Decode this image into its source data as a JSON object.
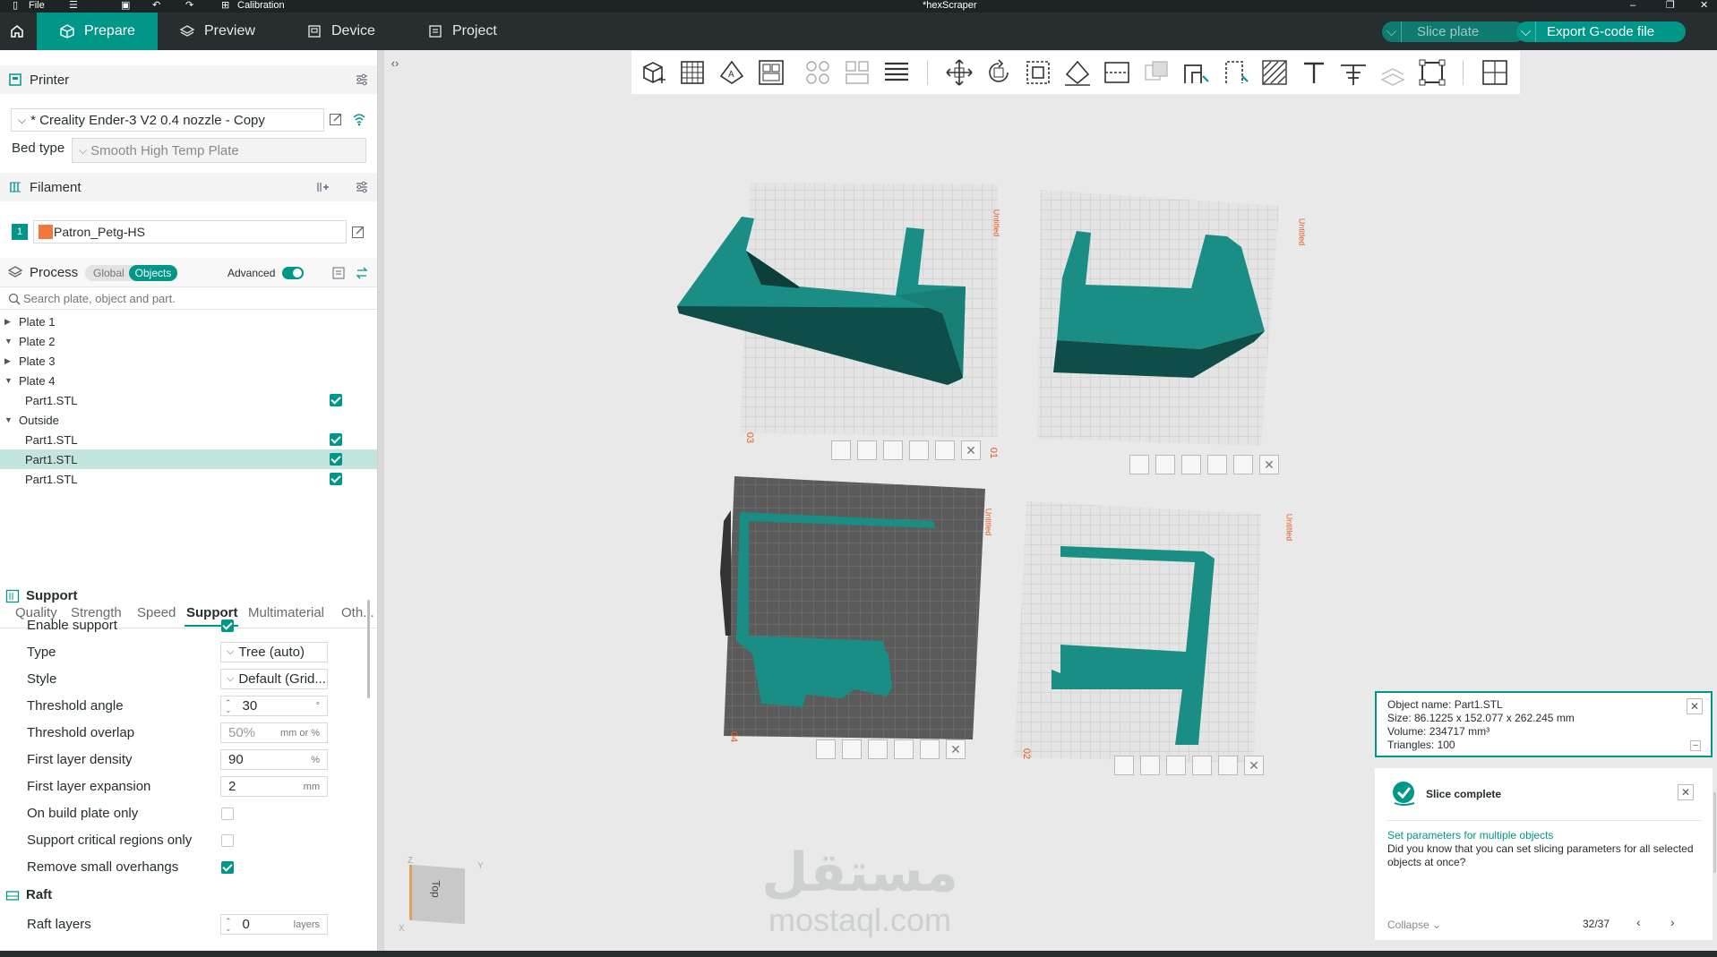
{
  "titlebar": {
    "file_label": "File",
    "calibration_label": "Calibration",
    "doc_title": "*hexScraper"
  },
  "nav": {
    "tabs": [
      {
        "label": "Prepare",
        "icon": "cube-icon"
      },
      {
        "label": "Preview",
        "icon": "layers-icon"
      },
      {
        "label": "Device",
        "icon": "device-icon"
      },
      {
        "label": "Project",
        "icon": "project-icon"
      }
    ],
    "slice_label": "Slice plate",
    "export_label": "Export G-code file"
  },
  "printer": {
    "section_label": "Printer",
    "name": "* Creality Ender-3 V2 0.4 nozzle - Copy",
    "bed_type_label": "Bed type",
    "bed_type_value": "Smooth High Temp Plate"
  },
  "filament": {
    "section_label": "Filament",
    "slot": "1",
    "name": "Patron_Petg-HS",
    "color": "#f07838"
  },
  "process": {
    "section_label": "Process",
    "global_label": "Global",
    "objects_label": "Objects",
    "advanced_label": "Advanced",
    "search_placeholder": "Search plate, object and part."
  },
  "tree": [
    {
      "label": "Plate 1",
      "level": 0,
      "expanded": false
    },
    {
      "label": "Plate 2",
      "level": 0,
      "expanded": true
    },
    {
      "label": "Plate 3",
      "level": 0,
      "expanded": false
    },
    {
      "label": "Plate 4",
      "level": 0,
      "expanded": true
    },
    {
      "label": "Part1.STL",
      "level": 1,
      "checked": true
    },
    {
      "label": "Outside",
      "level": 0,
      "expanded": true
    },
    {
      "label": "Part1.STL",
      "level": 1,
      "checked": true
    },
    {
      "label": "Part1.STL",
      "level": 1,
      "checked": true,
      "selected": true
    },
    {
      "label": "Part1.STL",
      "level": 1,
      "checked": true
    }
  ],
  "param_tabs": [
    "Quality",
    "Strength",
    "Speed",
    "Support",
    "Multimaterial",
    "Oth..."
  ],
  "support": {
    "section_label": "Support",
    "enable_label": "Enable support",
    "type_label": "Type",
    "type_value": "Tree (auto)",
    "style_label": "Style",
    "style_value": "Default (Grid...",
    "threshold_angle_label": "Threshold angle",
    "threshold_angle_value": "30",
    "threshold_angle_unit": "°",
    "threshold_overlap_label": "Threshold overlap",
    "threshold_overlap_value": "50%",
    "threshold_overlap_unit": "mm or %",
    "first_layer_density_label": "First layer density",
    "first_layer_density_value": "90",
    "first_layer_density_unit": "%",
    "first_layer_expansion_label": "First layer expansion",
    "first_layer_expansion_value": "2",
    "first_layer_expansion_unit": "mm",
    "on_build_plate_label": "On build plate only",
    "critical_regions_label": "Support critical regions only",
    "remove_overhangs_label": "Remove small overhangs"
  },
  "raft": {
    "section_label": "Raft",
    "layers_label": "Raft layers",
    "layers_value": "0",
    "layers_unit": "layers"
  },
  "plates": [
    {
      "number": "03",
      "label": "Untitled"
    },
    {
      "number": "01",
      "label": "Untitled"
    },
    {
      "number": "04",
      "label": "Untitled"
    },
    {
      "number": "02",
      "label": "Untitled"
    }
  ],
  "object_info": {
    "name": "Object name: Part1.STL",
    "size": "Size: 86.1225 x 152.077 x 262.245 mm",
    "volume": "Volume: 234717 mm³",
    "triangles": "Triangles: 100"
  },
  "notification": {
    "title": "Slice complete",
    "link": "Set parameters for multiple objects",
    "body": "Did you know that you can set slicing parameters for all selected objects at once?",
    "collapse_label": "Collapse",
    "counter": "32/37"
  },
  "navcube": {
    "face_label": "Top",
    "axis_x": "X",
    "axis_y": "Y",
    "axis_z": "Z"
  },
  "watermark": {
    "arabic": "مستقل",
    "latin": "mostaql.com"
  },
  "colors": {
    "accent": "#009688",
    "model": "#1a8e84",
    "dark_nav": "#262e30"
  }
}
